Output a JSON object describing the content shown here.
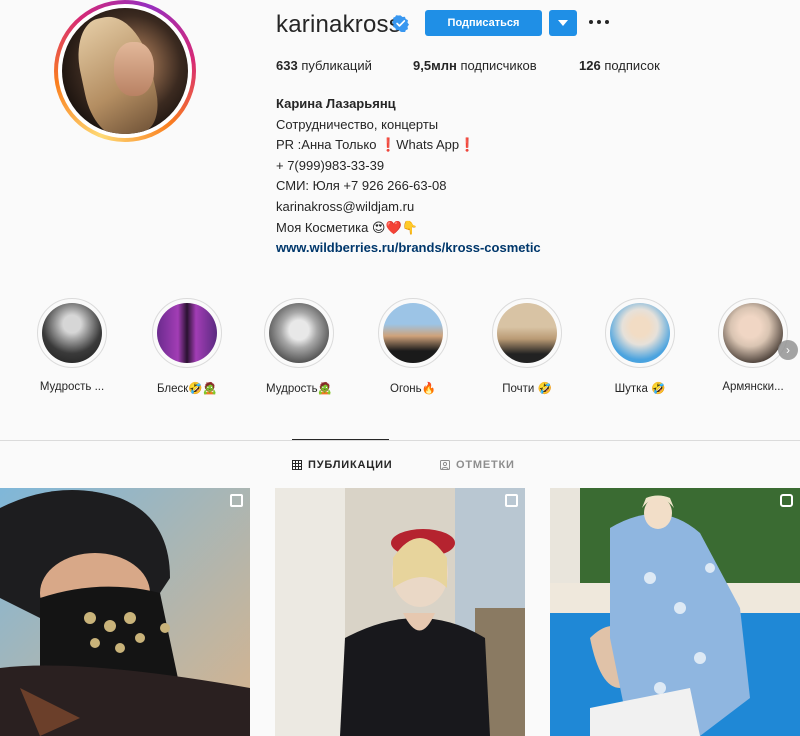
{
  "profile": {
    "username": "karinakross",
    "follow_label": "Подписаться",
    "stats": [
      {
        "value": "633",
        "label": "публикаций"
      },
      {
        "value": "9,5млн",
        "label": "подписчиков"
      },
      {
        "value": "126",
        "label": "подписок"
      }
    ],
    "bio": {
      "name": "Карина Лазарьянц",
      "lines": [
        "Сотрудничество, концерты",
        "PR :Анна Только ❗Whats App❗",
        "+ 7(999)983-33-39",
        "СМИ: Юля +7 926 266-63-08",
        "karinakross@wildjam.ru",
        "Моя Косметика 😍❤️👇"
      ],
      "link": "www.wildberries.ru/brands/kross-cosmetic"
    }
  },
  "highlights": [
    {
      "label": "Мудрость ..."
    },
    {
      "label": "Блеск🤣🧟"
    },
    {
      "label": "Мудрость🧟"
    },
    {
      "label": "Огонь🔥"
    },
    {
      "label": "Почти 🤣"
    },
    {
      "label": "Шутка 🤣"
    },
    {
      "label": "Армянски..."
    }
  ],
  "tabs": [
    {
      "label": "ПУБЛИКАЦИИ",
      "icon": "grid-icon",
      "active": true
    },
    {
      "label": "ОТМЕТКИ",
      "icon": "tag-icon",
      "active": false
    }
  ],
  "posts": [
    {
      "type": "carousel",
      "icon": "carousel-icon"
    },
    {
      "type": "carousel",
      "icon": "carousel-icon"
    },
    {
      "type": "igtv",
      "icon": "igtv-icon"
    }
  ],
  "colors": {
    "accent": "#1f8fe6",
    "link": "#00376b",
    "verified": "#3897f0",
    "text": "#262626",
    "muted": "#8e8e8e"
  }
}
